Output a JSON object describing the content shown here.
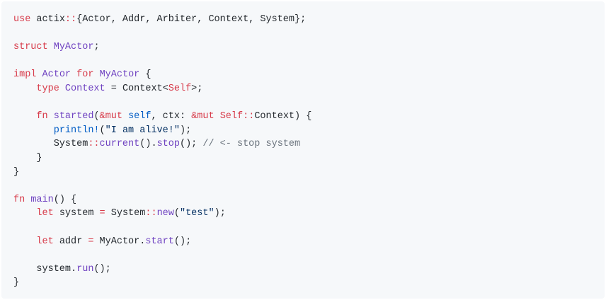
{
  "language": "rust",
  "colors": {
    "background": "#f6f8fa",
    "text": "#24292e",
    "keyword": "#d73a49",
    "type": "#6f42c1",
    "string": "#032f62",
    "self": "#005cc5",
    "comment": "#6a737d"
  },
  "lines": [
    [
      {
        "k": "k",
        "x": "use"
      },
      {
        "k": "",
        "x": " actix"
      },
      {
        "k": "p",
        "x": "::"
      },
      {
        "k": "",
        "x": "{Actor, Addr, Arbiter, Context, System};"
      }
    ],
    [],
    [
      {
        "k": "k",
        "x": "struct"
      },
      {
        "k": "",
        "x": " "
      },
      {
        "k": "t",
        "x": "MyActor"
      },
      {
        "k": "",
        "x": ";"
      }
    ],
    [],
    [
      {
        "k": "k",
        "x": "impl"
      },
      {
        "k": "",
        "x": " "
      },
      {
        "k": "t",
        "x": "Actor"
      },
      {
        "k": "",
        "x": " "
      },
      {
        "k": "k",
        "x": "for"
      },
      {
        "k": "",
        "x": " "
      },
      {
        "k": "t",
        "x": "MyActor"
      },
      {
        "k": "",
        "x": " {"
      }
    ],
    [
      {
        "k": "",
        "x": "    "
      },
      {
        "k": "k",
        "x": "type"
      },
      {
        "k": "",
        "x": " "
      },
      {
        "k": "t",
        "x": "Context"
      },
      {
        "k": "",
        "x": " = Context<"
      },
      {
        "k": "k",
        "x": "Self"
      },
      {
        "k": "",
        "x": ">;"
      }
    ],
    [],
    [
      {
        "k": "",
        "x": "    "
      },
      {
        "k": "k",
        "x": "fn"
      },
      {
        "k": "",
        "x": " "
      },
      {
        "k": "f",
        "x": "started"
      },
      {
        "k": "",
        "x": "("
      },
      {
        "k": "k",
        "x": "&mut"
      },
      {
        "k": "",
        "x": " "
      },
      {
        "k": "v",
        "x": "self"
      },
      {
        "k": "",
        "x": ", ctx: "
      },
      {
        "k": "k",
        "x": "&mut"
      },
      {
        "k": "",
        "x": " "
      },
      {
        "k": "k",
        "x": "Self"
      },
      {
        "k": "p",
        "x": "::"
      },
      {
        "k": "",
        "x": "Context) {"
      }
    ],
    [
      {
        "k": "",
        "x": "       "
      },
      {
        "k": "v",
        "x": "println!"
      },
      {
        "k": "",
        "x": "("
      },
      {
        "k": "s",
        "x": "\"I am alive!\""
      },
      {
        "k": "",
        "x": ");"
      }
    ],
    [
      {
        "k": "",
        "x": "       System"
      },
      {
        "k": "p",
        "x": "::"
      },
      {
        "k": "f",
        "x": "current"
      },
      {
        "k": "",
        "x": "()."
      },
      {
        "k": "f",
        "x": "stop"
      },
      {
        "k": "",
        "x": "(); "
      },
      {
        "k": "c",
        "x": "// <- stop system"
      }
    ],
    [
      {
        "k": "",
        "x": "    }"
      }
    ],
    [
      {
        "k": "",
        "x": "}"
      }
    ],
    [],
    [
      {
        "k": "k",
        "x": "fn"
      },
      {
        "k": "",
        "x": " "
      },
      {
        "k": "f",
        "x": "main"
      },
      {
        "k": "",
        "x": "() {"
      }
    ],
    [
      {
        "k": "",
        "x": "    "
      },
      {
        "k": "k",
        "x": "let"
      },
      {
        "k": "",
        "x": " system "
      },
      {
        "k": "p",
        "x": "="
      },
      {
        "k": "",
        "x": " System"
      },
      {
        "k": "p",
        "x": "::"
      },
      {
        "k": "f",
        "x": "new"
      },
      {
        "k": "",
        "x": "("
      },
      {
        "k": "s",
        "x": "\"test\""
      },
      {
        "k": "",
        "x": ");"
      }
    ],
    [],
    [
      {
        "k": "",
        "x": "    "
      },
      {
        "k": "k",
        "x": "let"
      },
      {
        "k": "",
        "x": " addr "
      },
      {
        "k": "p",
        "x": "="
      },
      {
        "k": "",
        "x": " MyActor."
      },
      {
        "k": "f",
        "x": "start"
      },
      {
        "k": "",
        "x": "();"
      }
    ],
    [],
    [
      {
        "k": "",
        "x": "    system."
      },
      {
        "k": "f",
        "x": "run"
      },
      {
        "k": "",
        "x": "();"
      }
    ],
    [
      {
        "k": "",
        "x": "}"
      }
    ]
  ]
}
